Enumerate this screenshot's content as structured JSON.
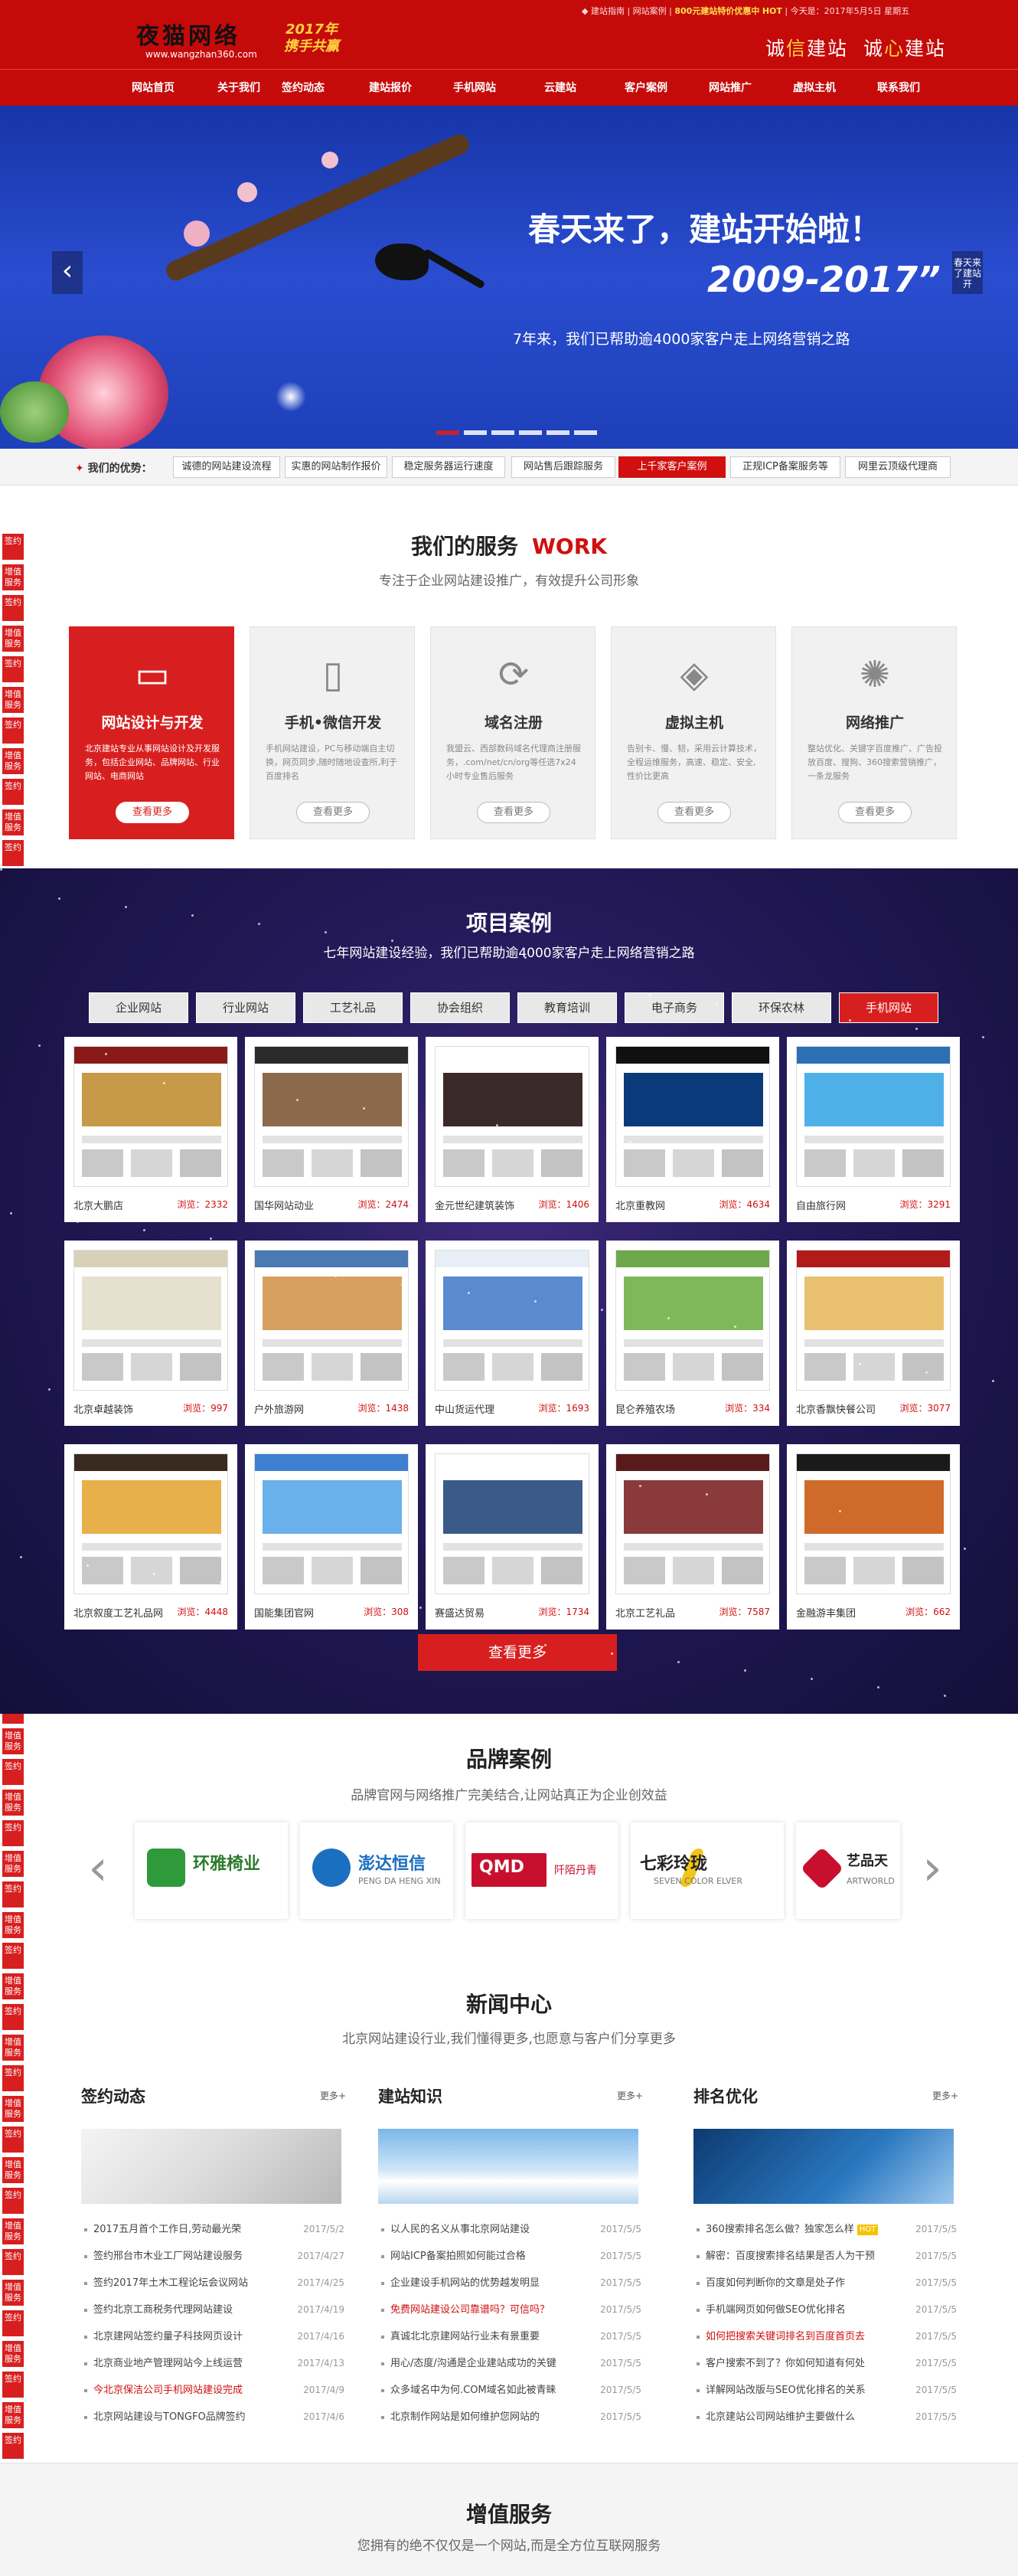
{
  "header": {
    "logo_text": "夜猫网络",
    "logo_url": "www.wangzhan360.com",
    "slogan_line1": "2017年",
    "slogan_line2": "携手共赢",
    "top_links": [
      "建站指南",
      "网站案例"
    ],
    "promo": "800元建站特价优惠中",
    "promo_tag": "HOT",
    "greeting": "今天是：2017年5月5日 星期五",
    "honesty_a": "诚",
    "honesty_b": "信",
    "honesty_c": "建站",
    "honesty_d": "诚",
    "honesty_e": "心",
    "honesty_f": "建站"
  },
  "nav": [
    "网站首页",
    "关于我们",
    "签约动态",
    "建站报价",
    "手机网站",
    "云建站",
    "客户案例",
    "网站推广",
    "虚拟主机",
    "联系我们"
  ],
  "banner": {
    "headline": "春天来了，建站开始啦！",
    "years": "2009-2017”",
    "desc": "7年来，我们已帮助逾4000家客户走上网络营销之路",
    "prev": "‹",
    "next_caption": "春天来了建站开"
  },
  "advantages": {
    "label_prefix": "我们的优势：",
    "items": [
      "诚德的网站建设流程",
      "实惠的网站制作报价",
      "稳定服务器运行速度",
      "网站售后跟踪服务",
      "上千家客户案例",
      "正规ICP备案服务等",
      "网里云顶级代理商"
    ],
    "active_index": 4
  },
  "sidebar": {
    "labels": [
      "签约",
      "增值服务",
      "签约",
      "增值服务",
      "签约",
      "增值服务"
    ]
  },
  "services": {
    "title": "我们的服务",
    "title_en": "WORK",
    "subtitle": "专注于企业网站建设推广，有效提升公司形象",
    "items": [
      {
        "name": "网站设计与开发",
        "desc": "北京建站专业从事网站设计及开发服务，包括企业网站、品牌网站、行业网站、电商网站",
        "more": "查看更多",
        "icon": "▭"
      },
      {
        "name": "手机•微信开发",
        "desc": "手机网站建设，PC与移动端自主切换，网页同步,随时随地设查所,利于百度排名",
        "more": "查看更多",
        "icon": "▯"
      },
      {
        "name": "域名注册",
        "desc": "我盟云、西部数码域名代理商注册服务，.com/net/cn/org等任选7x24小时专业售后服务",
        "more": "查看更多",
        "icon": "⟳"
      },
      {
        "name": "虚拟主机",
        "desc": "告别卡、慢、韧，采用云计算技术，全程运维服务，高速、稳定、安全,性价比更高",
        "more": "查看更多",
        "icon": "◈"
      },
      {
        "name": "网络推广",
        "desc": "整站优化、关键字百度推广、广告投放百度、搜狗、360搜索营销推广，一条龙服务",
        "more": "查看更多",
        "icon": "✺"
      }
    ]
  },
  "cases": {
    "title": "项目案例",
    "subtitle": "七年网站建设经验，我们已帮助逾4000家客户走上网络营销之路",
    "tabs": [
      "企业网站",
      "行业网站",
      "工艺礼品",
      "协会组织",
      "教育培训",
      "电子商务",
      "环保农林",
      "手机网站"
    ],
    "active_tab": 7,
    "view_label": "浏览：",
    "items": [
      {
        "name": "北京大鹏店",
        "views": "2332"
      },
      {
        "name": "国华网站动业",
        "views": "2474"
      },
      {
        "name": "金元世纪建筑装饰",
        "views": "1406"
      },
      {
        "name": "北京重教网",
        "views": "4634"
      },
      {
        "name": "自由旅行网",
        "views": "3291"
      },
      {
        "name": "北京卓越装饰",
        "views": "997"
      },
      {
        "name": "户外旅游网",
        "views": "1438"
      },
      {
        "name": "中山货运代理",
        "views": "1693"
      },
      {
        "name": "昆仑养殖农场",
        "views": "334"
      },
      {
        "name": "北京香飘快餐公司",
        "views": "3077"
      },
      {
        "name": "北京叙度工艺礼品网",
        "views": "4448"
      },
      {
        "name": "国能集团官网",
        "views": "308"
      },
      {
        "name": "赛盛达贸易",
        "views": "1734"
      },
      {
        "name": "北京工艺礼品",
        "views": "7587"
      },
      {
        "name": "金融游丰集团",
        "views": "662"
      }
    ],
    "more": "查看更多"
  },
  "brands": {
    "title": "品牌案例",
    "subtitle": "品牌官网与网络推广完美结合,让网站真正为企业创效益",
    "items": [
      {
        "name": "环雅椅业",
        "sub": ""
      },
      {
        "name": "澎达恒信",
        "sub": "PENG DA HENG XIN"
      },
      {
        "name": "QMD",
        "sub": "阡陌丹青"
      },
      {
        "name": "七彩玲珑",
        "sub": "SEVEN COLOR ELVER"
      },
      {
        "name": "艺品天",
        "sub": "ARTWORLD"
      }
    ]
  },
  "news": {
    "title": "新闻中心",
    "subtitle": "北京网站建设行业,我们懂得更多,也愿意与客户们分享更多",
    "more": "更多+",
    "columns": [
      {
        "title": "签约动态",
        "items": [
          {
            "t": "2017五月首个工作日,劳动最光荣",
            "d": "2017/5/2"
          },
          {
            "t": "签约邢台市木业工厂网站建设服务",
            "d": "2017/4/27"
          },
          {
            "t": "签约2017年土木工程论坛会议网站",
            "d": "2017/4/25"
          },
          {
            "t": "签约北京工商税务代理网站建设",
            "d": "2017/4/19"
          },
          {
            "t": "北京建网站签约量子科技网页设计",
            "d": "2017/4/16"
          },
          {
            "t": "北京商业地产管理网站今上线运营",
            "d": "2017/4/13"
          },
          {
            "t": "今北京保洁公司手机网站建设完成",
            "d": "2017/4/9"
          },
          {
            "t": "北京网站建设与TONGFO品牌签约",
            "d": "2017/4/6"
          }
        ]
      },
      {
        "title": "建站知识",
        "items": [
          {
            "t": "以人民的名义从事北京网站建设",
            "d": "2017/5/5"
          },
          {
            "t": "网站ICP备案拍照如何能过合格",
            "d": "2017/5/5"
          },
          {
            "t": "企业建设手机网站的优势越发明显",
            "d": "2017/5/5"
          },
          {
            "t": "免费网站建设公司靠谱吗？可信吗？",
            "d": "2017/5/5"
          },
          {
            "t": "真诚北北京建网站行业未有景重要",
            "d": "2017/5/5"
          },
          {
            "t": "用心/态度/沟通是企业建站成功的关键",
            "d": "2017/5/5"
          },
          {
            "t": "众多域名中为何.COM域名如此被青睐",
            "d": "2017/5/5"
          },
          {
            "t": "北京制作网站是如何维护您网站的",
            "d": "2017/5/5"
          }
        ]
      },
      {
        "title": "排名优化",
        "items": [
          {
            "t": "360搜索排名怎么做？独家怎么样",
            "d": "2017/5/5",
            "hot": "HOT"
          },
          {
            "t": "解密：百度搜索排名结果是否人为干预",
            "d": "2017/5/5"
          },
          {
            "t": "百度如何判断你的文章是处子作",
            "d": "2017/5/5"
          },
          {
            "t": "手机端网页如何做SEO优化排名",
            "d": "2017/5/5"
          },
          {
            "t": "如何把搜索关键词排名到百度首页去",
            "d": "2017/5/5"
          },
          {
            "t": "客户搜索不到了？你如何知道有何处",
            "d": "2017/5/5"
          },
          {
            "t": "详解网站改版与SEO优化排名的关系",
            "d": "2017/5/5"
          },
          {
            "t": "北京建站公司网站维护主要做什么",
            "d": "2017/5/5"
          }
        ]
      }
    ]
  },
  "value_added": {
    "title": "增值服务",
    "subtitle": "您拥有的绝不仅仅是一个网站,而是全方位互联网服务"
  },
  "colors": {
    "brand_red": "#c50a0a",
    "accent_red": "#d81f1f",
    "highlight_gold": "#ffd23c",
    "banner_blue": "#2a4dd0",
    "cases_bg": "#241a5a"
  }
}
